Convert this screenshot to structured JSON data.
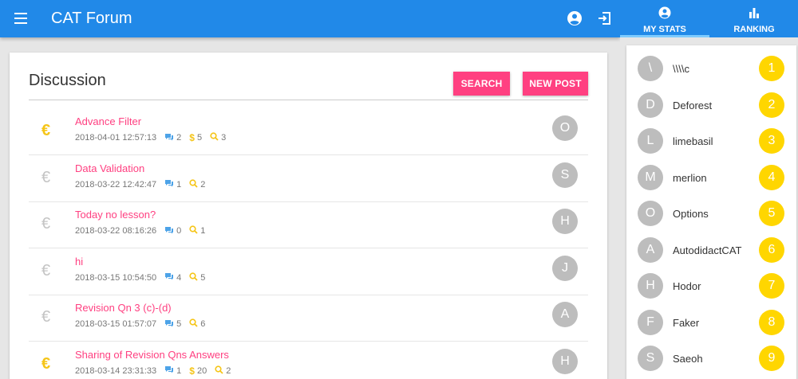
{
  "app": {
    "title": "CAT Forum"
  },
  "colors": {
    "primary": "#2189e8",
    "accent": "#ff4081",
    "gold": "#f5c518",
    "comment_blue": "#4da3e8"
  },
  "discussion": {
    "title": "Discussion",
    "search_label": "SEARCH",
    "new_post_label": "NEW POST",
    "posts": [
      {
        "title": "Advance Filter",
        "date": "2018-04-01 12:57:13",
        "comments": "2",
        "bounty": "5",
        "views": "3",
        "author_initial": "O",
        "paid": true
      },
      {
        "title": "Data Validation",
        "date": "2018-03-22 12:42:47",
        "comments": "1",
        "bounty": null,
        "views": "2",
        "author_initial": "S",
        "paid": false
      },
      {
        "title": "Today no lesson?",
        "date": "2018-03-22 08:16:26",
        "comments": "0",
        "bounty": null,
        "views": "1",
        "author_initial": "H",
        "paid": false
      },
      {
        "title": "hi",
        "date": "2018-03-15 10:54:50",
        "comments": "4",
        "bounty": null,
        "views": "5",
        "author_initial": "J",
        "paid": false
      },
      {
        "title": "Revision Qn 3 (c)-(d)",
        "date": "2018-03-15 01:57:07",
        "comments": "5",
        "bounty": null,
        "views": "6",
        "author_initial": "A",
        "paid": false
      },
      {
        "title": "Sharing of Revision Qns Answers",
        "date": "2018-03-14 23:31:33",
        "comments": "1",
        "bounty": "20",
        "views": "2",
        "author_initial": "H",
        "paid": true
      }
    ]
  },
  "sidebar": {
    "tabs": [
      {
        "label": "MY STATS",
        "icon": "account-circle-icon"
      },
      {
        "label": "RANKING",
        "icon": "bar-chart-icon"
      }
    ],
    "ranking": [
      {
        "initial": "\\",
        "name": "\\\\\\\\c",
        "rank": "1"
      },
      {
        "initial": "D",
        "name": "Deforest",
        "rank": "2"
      },
      {
        "initial": "L",
        "name": "limebasil",
        "rank": "3"
      },
      {
        "initial": "M",
        "name": "merlion",
        "rank": "4"
      },
      {
        "initial": "O",
        "name": "Options",
        "rank": "5"
      },
      {
        "initial": "A",
        "name": "AutodidactCAT",
        "rank": "6"
      },
      {
        "initial": "H",
        "name": "Hodor",
        "rank": "7"
      },
      {
        "initial": "F",
        "name": "Faker",
        "rank": "8"
      },
      {
        "initial": "S",
        "name": "Saeoh",
        "rank": "9"
      }
    ]
  }
}
